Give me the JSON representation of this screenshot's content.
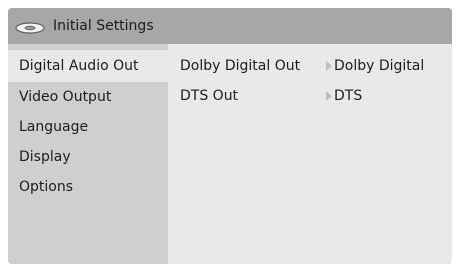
{
  "header": {
    "title": "Initial Settings",
    "icon": "disc-icon"
  },
  "menu": {
    "items": [
      {
        "label": "Digital Audio Out",
        "active": true
      },
      {
        "label": "Video Output",
        "active": false
      },
      {
        "label": "Language",
        "active": false
      },
      {
        "label": "Display",
        "active": false
      },
      {
        "label": "Options",
        "active": false
      }
    ]
  },
  "settings": {
    "rows": [
      {
        "label": "Dolby Digital Out",
        "value": "Dolby Digital",
        "icon": "arrow-right-icon"
      },
      {
        "label": "DTS Out",
        "value": "DTS",
        "icon": "arrow-right-icon"
      }
    ]
  },
  "colors": {
    "title_bar": "#a7a7a7",
    "menu_background": "#cfcfcf",
    "content_background": "#e9e9e9",
    "text": "#1c1c1c",
    "arrow": "#bdbdbd"
  }
}
